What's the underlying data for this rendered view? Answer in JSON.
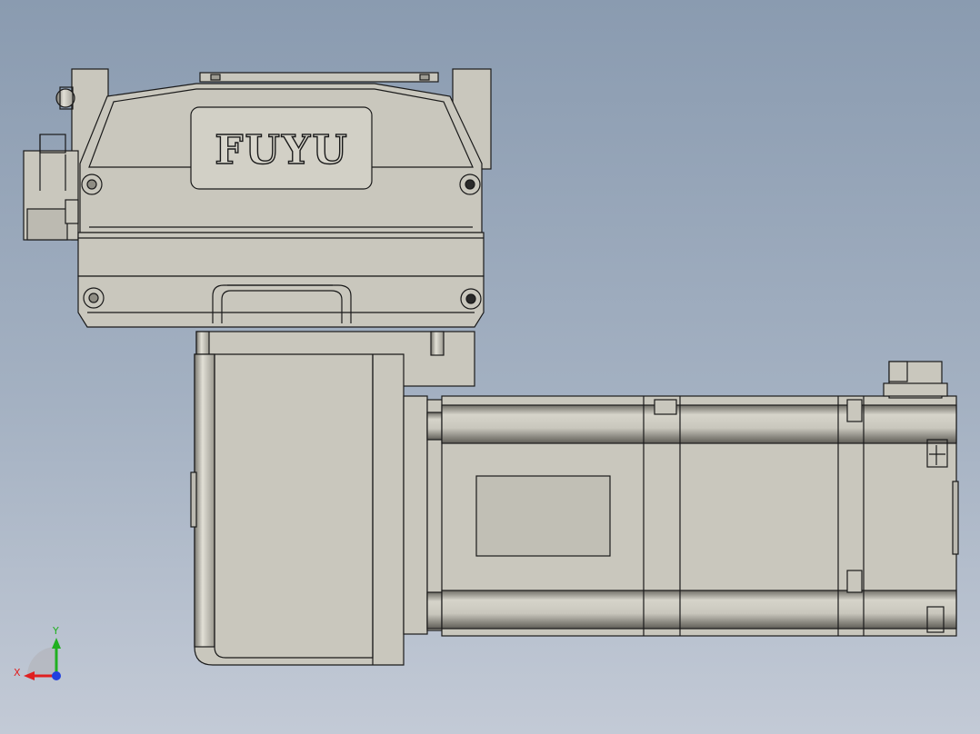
{
  "viewport": {
    "background_top": "#8a9bb0",
    "background_bottom": "#c3cad6"
  },
  "model": {
    "logo_text": "FUYU",
    "body_color": "#c9c7bd",
    "edge_color": "#1a1a1a",
    "shade_color": "#8f8d84"
  },
  "triad": {
    "x_label": "X",
    "y_label": "Y",
    "x_color": "#e02020",
    "y_color": "#20b020",
    "z_color": "#2040e0"
  }
}
